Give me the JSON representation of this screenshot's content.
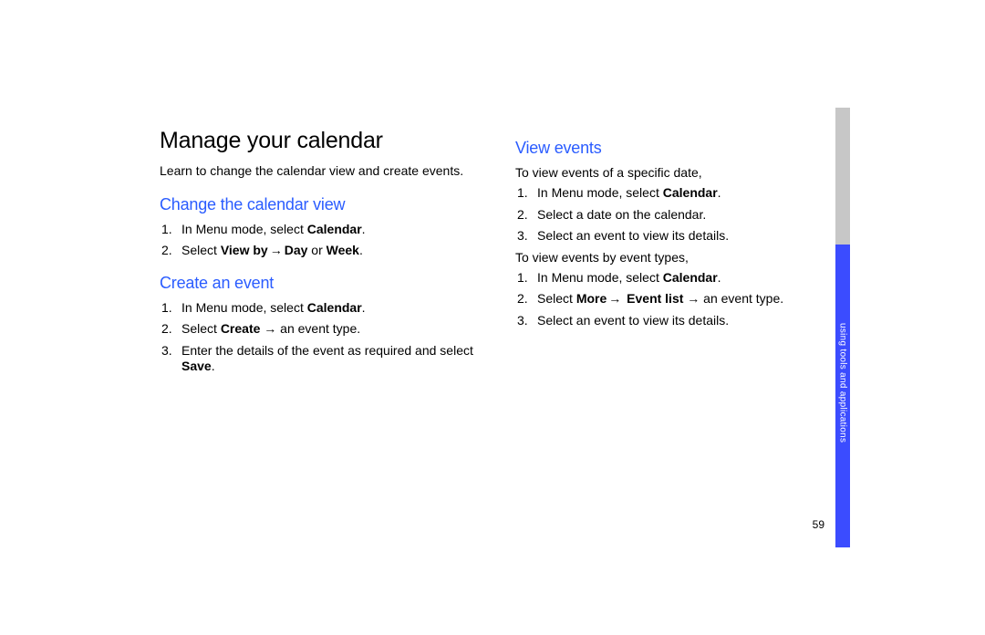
{
  "page_number": "59",
  "side_label": "using tools and applications",
  "left": {
    "title": "Manage your calendar",
    "intro": "Learn to change the calendar view and create events.",
    "section1": {
      "heading": "Change the calendar view",
      "items": [
        {
          "pre": "In Menu mode, select ",
          "b1": "Calendar",
          "post": "."
        },
        {
          "pre": "Select ",
          "b1": "View by",
          "mid": " → ",
          "b2": "Day",
          "mid2": " or ",
          "b3": "Week",
          "post": "."
        }
      ]
    },
    "section2": {
      "heading": "Create an event",
      "items": [
        {
          "pre": "In Menu mode, select ",
          "b1": "Calendar",
          "post": "."
        },
        {
          "pre": "Select ",
          "b1": "Create",
          "mid": " → an event type.",
          "post": ""
        },
        {
          "pre": "Enter the details of the event as required and select ",
          "b1": "Save",
          "post": "."
        }
      ]
    }
  },
  "right": {
    "section1": {
      "heading": "View events",
      "lead": "To view events of a specific date,",
      "items": [
        {
          "pre": "In Menu mode, select ",
          "b1": "Calendar",
          "post": "."
        },
        {
          "pre": "Select a date on the calendar.",
          "post": ""
        },
        {
          "pre": "Select an event to view its details.",
          "post": ""
        }
      ],
      "lead2": "To view events by event types,",
      "items2": [
        {
          "pre": "In Menu mode, select ",
          "b1": "Calendar",
          "post": "."
        },
        {
          "pre": "Select ",
          "b1": "More",
          "mid": " → ",
          "b2": " Event list",
          "mid2": " → an event type.",
          "post": ""
        },
        {
          "pre": "Select an event to view its details.",
          "post": ""
        }
      ]
    }
  }
}
